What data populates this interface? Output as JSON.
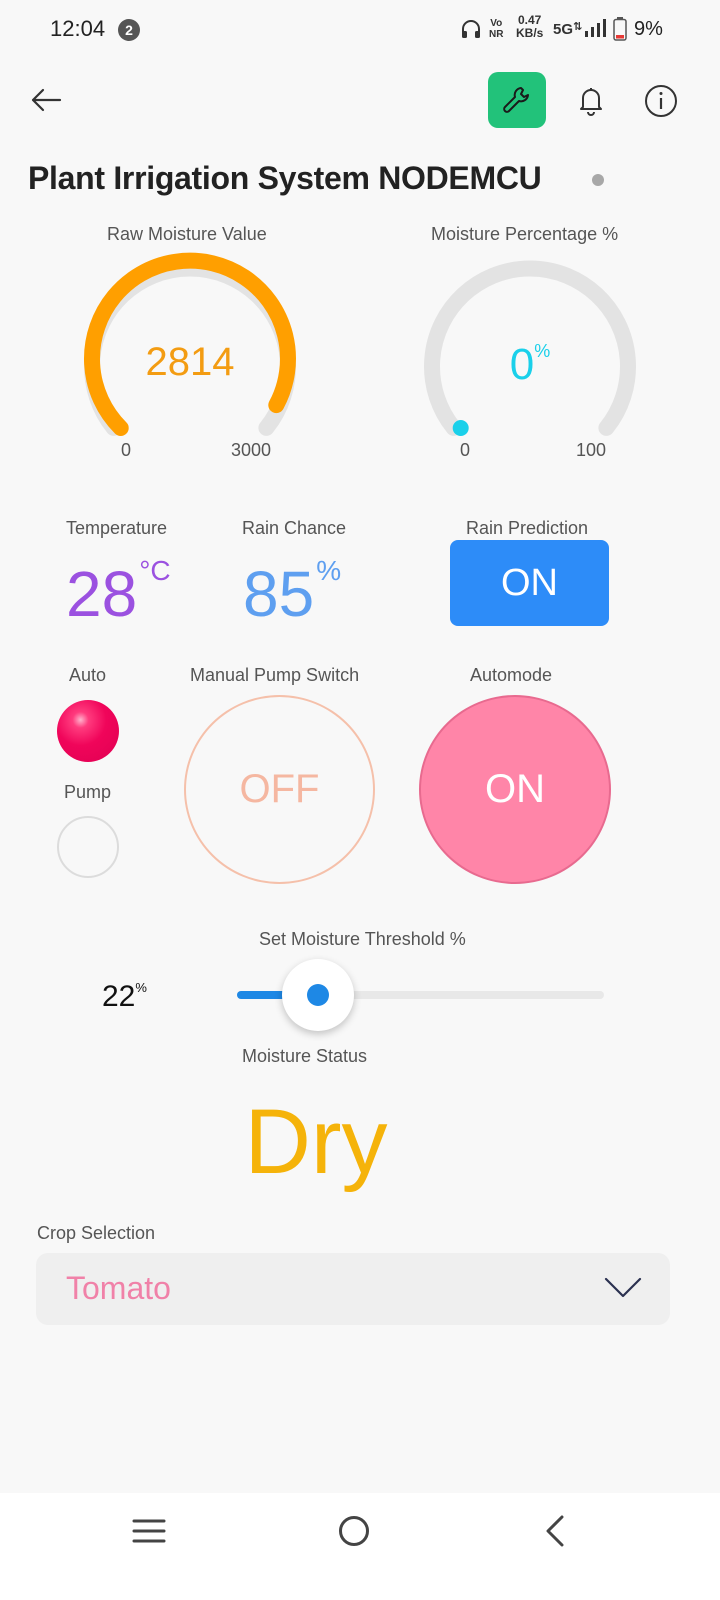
{
  "status_bar": {
    "time": "12:04",
    "notification_count": "2",
    "vonr_line1": "Vo",
    "vonr_line2": "NR",
    "speed_value": "0.47",
    "speed_unit": "KB/s",
    "network": "5G",
    "battery": "9%"
  },
  "header": {
    "title": "Plant Irrigation System NODEMCU",
    "icons": [
      "back-arrow-icon",
      "wrench-icon",
      "bell-icon",
      "info-icon"
    ],
    "accent_color": "#22c27a"
  },
  "gauges": [
    {
      "label": "Raw Moisture Value",
      "value": "2814",
      "min": "0",
      "max": "3000",
      "fraction": 0.938,
      "color": "#f39c12"
    },
    {
      "label": "Moisture Percentage %",
      "value": "0",
      "unit": "%",
      "min": "0",
      "max": "100",
      "fraction": 0.0,
      "color": "#1ad0ea"
    }
  ],
  "temperature": {
    "label": "Temperature",
    "value": "28",
    "unit": "°C",
    "color": "#9b51e0"
  },
  "rain_chance": {
    "label": "Rain Chance",
    "value": "85",
    "unit": "%",
    "color": "#5e9ff0"
  },
  "rain_prediction": {
    "label": "Rain Prediction",
    "state": "ON",
    "color": "#2d8cf8"
  },
  "leds": {
    "auto_label": "Auto",
    "auto_state": "on",
    "pump_label": "Pump",
    "pump_state": "off"
  },
  "manual_pump": {
    "label": "Manual Pump Switch",
    "state": "OFF"
  },
  "automode": {
    "label": "Automode",
    "state": "ON",
    "color": "#ff85a8"
  },
  "threshold": {
    "label": "Set Moisture Threshold %",
    "value": "22",
    "unit": "%",
    "fraction": 0.22
  },
  "moisture_status": {
    "label": "Moisture Status",
    "value": "Dry",
    "color": "#f5b30a"
  },
  "crop_selection": {
    "label": "Crop Selection",
    "value": "Tomato"
  },
  "nav": [
    "menu-icon",
    "home-icon",
    "back-icon"
  ]
}
